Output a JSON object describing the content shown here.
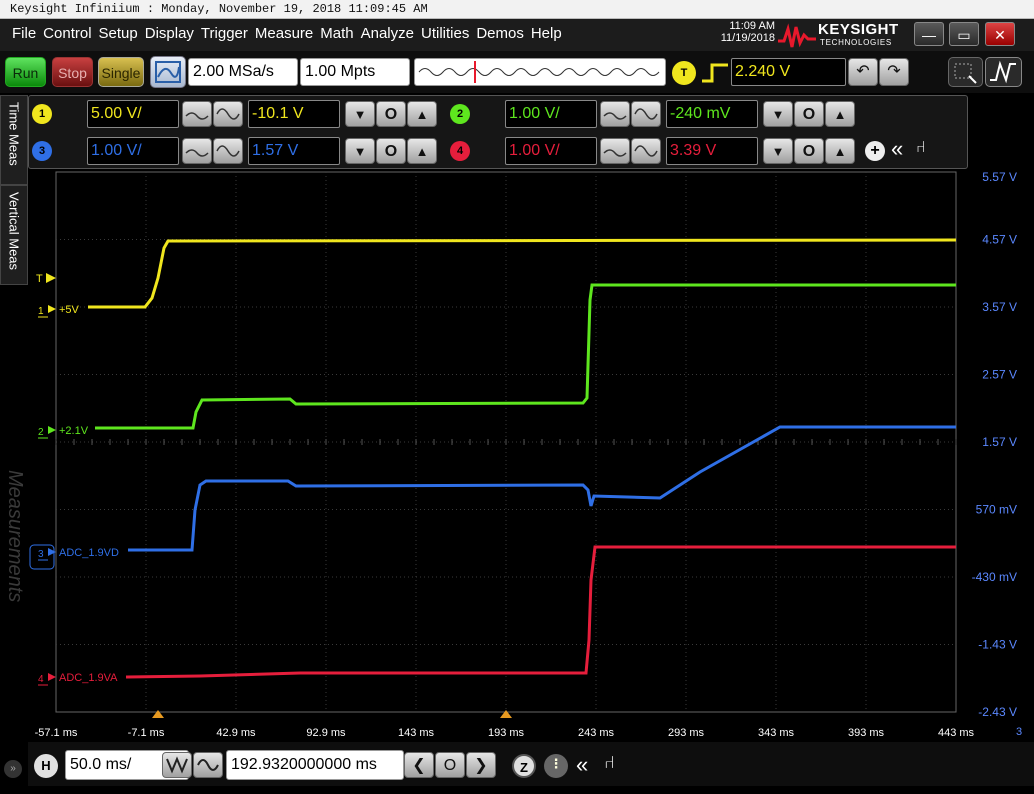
{
  "titlebar": {
    "text": "Keysight Infiniium : Monday, November 19, 2018 11:09:45 AM"
  },
  "menu": [
    "File",
    "Control",
    "Setup",
    "Display",
    "Trigger",
    "Measure",
    "Math",
    "Analyze",
    "Utilities",
    "Demos",
    "Help"
  ],
  "clock": {
    "time": "11:09 AM",
    "date": "11/19/2018"
  },
  "brand": {
    "name": "KEYSIGHT",
    "sub": "TECHNOLOGIES"
  },
  "toolbar": {
    "run": "Run",
    "stop": "Stop",
    "single": "Single",
    "sample_rate": "2.00 MSa/s",
    "memory_depth": "1.00 Mpts",
    "trigger_badge": "T",
    "trigger_level": "2.240 V"
  },
  "channels": [
    {
      "num": "1",
      "coupling": "1MΩ DC",
      "scale": "5.00 V/",
      "offset": "-10.1 V",
      "color": "#f0e61e"
    },
    {
      "num": "2",
      "coupling": "1MΩ DC",
      "scale": "1.00 V/",
      "offset": "-240 mV",
      "color": "#5ee61e"
    },
    {
      "num": "3",
      "coupling": "1MΩ DC",
      "scale": "1.00 V/",
      "offset": "1.57 V",
      "color": "#2f6fe6"
    },
    {
      "num": "4",
      "coupling": "1MΩ DC",
      "scale": "1.00 V/",
      "offset": "3.39 V",
      "color": "#e61e3c"
    }
  ],
  "sidetabs": {
    "time_meas": "Time Meas",
    "vertical_meas": "Vertical Meas",
    "measurements": "Measurements"
  },
  "markers": {
    "trigger": "T",
    "ch1": "+5V",
    "ch2": "+2.1V",
    "ch3": "ADC_1.9VD",
    "ch4": "ADC_1.9VA"
  },
  "right_axis": [
    "5.57 V",
    "4.57 V",
    "3.57 V",
    "2.57 V",
    "1.57 V",
    "570 mV",
    "-430 mV",
    "-1.43 V",
    "-2.43 V"
  ],
  "x_axis": [
    "-57.1 ms",
    "-7.1 ms",
    "42.9 ms",
    "92.9 ms",
    "143 ms",
    "193 ms",
    "243 ms",
    "293 ms",
    "343 ms",
    "393 ms",
    "443 ms"
  ],
  "x_axis_suffix": "3",
  "bottom": {
    "h_badge": "H",
    "timebase": "50.0 ms/",
    "position": "192.9320000000 ms",
    "z_badge": "Z"
  }
}
